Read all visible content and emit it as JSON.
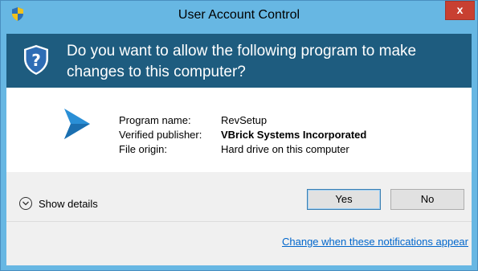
{
  "window": {
    "title": "User Account Control",
    "close_label": "x"
  },
  "header": {
    "question": "Do you want to allow the following program to make changes to this computer?"
  },
  "program": {
    "icon": "play-triangle-icon",
    "rows": [
      {
        "label": "Program name:",
        "value": "RevSetup"
      },
      {
        "label": "Verified publisher:",
        "value": "VBrick Systems Incorporated"
      },
      {
        "label": "File origin:",
        "value": "Hard drive on this computer"
      }
    ]
  },
  "footer": {
    "details_label": "Show details",
    "yes_label": "Yes",
    "no_label": "No",
    "link_label": "Change when these notifications appear"
  },
  "colors": {
    "frame": "#67b7e3",
    "header_bg": "#1e5c7f",
    "close_bg": "#c84031",
    "link": "#0066cc",
    "program_icon": "#2a8fd6"
  }
}
